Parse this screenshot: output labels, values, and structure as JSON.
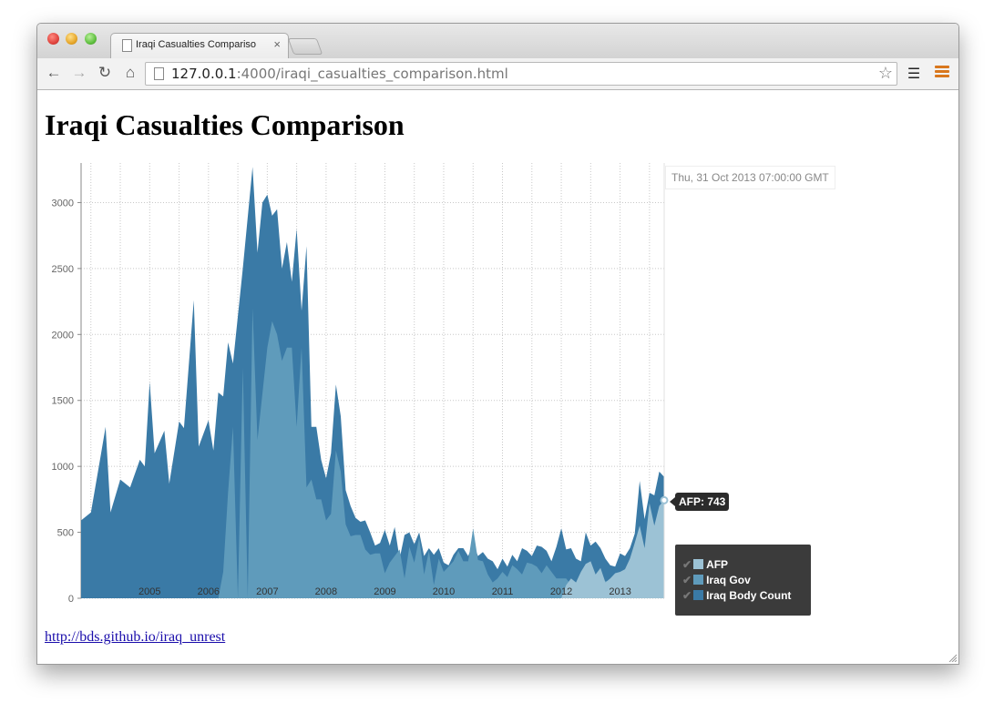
{
  "browser": {
    "tab_title": "Iraqi Casualties Compariso",
    "tab_close": "×",
    "url_host": "127.0.0.1",
    "url_rest": ":4000/iraqi_casualties_comparison.html"
  },
  "page": {
    "title": "Iraqi Casualties Comparison",
    "footer_link": "http://bds.github.io/iraq_unrest",
    "hover_date": "Thu, 31 Oct 2013 07:00:00 GMT",
    "tooltip": "AFP: 743"
  },
  "legend": {
    "items": [
      {
        "label": "AFP",
        "color": "#9cc2d5"
      },
      {
        "label": "Iraq Gov",
        "color": "#5f9bbb"
      },
      {
        "label": "Iraq Body Count",
        "color": "#3a7aa6"
      }
    ]
  },
  "chart_data": {
    "type": "area",
    "title": "Iraqi Casualties Comparison",
    "xlabel": "",
    "ylabel": "",
    "x_ticks": [
      "2005",
      "2006",
      "2007",
      "2008",
      "2009",
      "2010",
      "2011",
      "2012",
      "2013"
    ],
    "y_ticks": [
      0,
      500,
      1000,
      1500,
      2000,
      2500,
      3000
    ],
    "ylim": [
      0,
      3300
    ],
    "xlim": [
      "2003-11",
      "2013-10"
    ],
    "grid": true,
    "legend_position": "bottom-right",
    "series": [
      {
        "name": "Iraq Body Count",
        "color": "#3a7aa6",
        "points": [
          [
            "2003-11",
            590
          ],
          [
            "2004-01",
            650
          ],
          [
            "2004-03",
            1080
          ],
          [
            "2004-04",
            1300
          ],
          [
            "2004-05",
            650
          ],
          [
            "2004-07",
            900
          ],
          [
            "2004-09",
            840
          ],
          [
            "2004-11",
            1050
          ],
          [
            "2004-12",
            1000
          ],
          [
            "2005-01",
            1640
          ],
          [
            "2005-02",
            1100
          ],
          [
            "2005-04",
            1270
          ],
          [
            "2005-05",
            870
          ],
          [
            "2005-07",
            1340
          ],
          [
            "2005-08",
            1290
          ],
          [
            "2005-10",
            2260
          ],
          [
            "2005-11",
            1150
          ],
          [
            "2006-01",
            1350
          ],
          [
            "2006-02",
            1120
          ],
          [
            "2006-03",
            1560
          ],
          [
            "2006-04",
            1530
          ],
          [
            "2006-05",
            1940
          ],
          [
            "2006-06",
            1780
          ],
          [
            "2006-08",
            2500
          ],
          [
            "2006-10",
            3270
          ],
          [
            "2006-11",
            2620
          ],
          [
            "2006-12",
            3000
          ],
          [
            "2007-01",
            3060
          ],
          [
            "2007-02",
            2900
          ],
          [
            "2007-03",
            2950
          ],
          [
            "2007-04",
            2500
          ],
          [
            "2007-05",
            2700
          ],
          [
            "2007-06",
            2400
          ],
          [
            "2007-07",
            2800
          ],
          [
            "2007-08",
            2180
          ],
          [
            "2007-09",
            2670
          ],
          [
            "2007-10",
            1300
          ],
          [
            "2007-11",
            1300
          ],
          [
            "2007-12",
            1050
          ],
          [
            "2008-01",
            910
          ],
          [
            "2008-02",
            1100
          ],
          [
            "2008-03",
            1620
          ],
          [
            "2008-04",
            1380
          ],
          [
            "2008-05",
            820
          ],
          [
            "2008-06",
            700
          ],
          [
            "2008-07",
            610
          ],
          [
            "2008-08",
            580
          ],
          [
            "2008-09",
            590
          ],
          [
            "2008-10",
            500
          ],
          [
            "2008-11",
            400
          ],
          [
            "2008-12",
            420
          ],
          [
            "2009-01",
            520
          ],
          [
            "2009-02",
            400
          ],
          [
            "2009-03",
            540
          ],
          [
            "2009-04",
            300
          ],
          [
            "2009-05",
            480
          ],
          [
            "2009-06",
            500
          ],
          [
            "2009-07",
            410
          ],
          [
            "2009-08",
            500
          ],
          [
            "2009-09",
            320
          ],
          [
            "2009-10",
            380
          ],
          [
            "2009-11",
            330
          ],
          [
            "2009-12",
            380
          ],
          [
            "2010-01",
            270
          ],
          [
            "2010-02",
            250
          ],
          [
            "2010-03",
            330
          ],
          [
            "2010-04",
            380
          ],
          [
            "2010-05",
            380
          ],
          [
            "2010-06",
            320
          ],
          [
            "2010-07",
            420
          ],
          [
            "2010-08",
            320
          ],
          [
            "2010-09",
            350
          ],
          [
            "2010-10",
            300
          ],
          [
            "2010-11",
            280
          ],
          [
            "2010-12",
            220
          ],
          [
            "2011-01",
            300
          ],
          [
            "2011-02",
            240
          ],
          [
            "2011-03",
            330
          ],
          [
            "2011-04",
            280
          ],
          [
            "2011-05",
            380
          ],
          [
            "2011-06",
            360
          ],
          [
            "2011-07",
            320
          ],
          [
            "2011-08",
            400
          ],
          [
            "2011-09",
            390
          ],
          [
            "2011-10",
            360
          ],
          [
            "2011-11",
            280
          ],
          [
            "2011-12",
            390
          ],
          [
            "2012-01",
            530
          ],
          [
            "2012-02",
            370
          ],
          [
            "2012-03",
            380
          ],
          [
            "2012-04",
            300
          ],
          [
            "2012-05",
            280
          ],
          [
            "2012-06",
            500
          ],
          [
            "2012-07",
            400
          ],
          [
            "2012-08",
            430
          ],
          [
            "2012-09",
            380
          ],
          [
            "2012-10",
            300
          ],
          [
            "2012-11",
            250
          ],
          [
            "2012-12",
            240
          ],
          [
            "2013-01",
            340
          ],
          [
            "2013-02",
            320
          ],
          [
            "2013-03",
            380
          ],
          [
            "2013-04",
            490
          ],
          [
            "2013-05",
            890
          ],
          [
            "2013-06",
            600
          ],
          [
            "2013-07",
            800
          ],
          [
            "2013-08",
            780
          ],
          [
            "2013-09",
            960
          ],
          [
            "2013-10",
            920
          ]
        ]
      },
      {
        "name": "Iraq Gov",
        "color": "#5f9bbb",
        "points": [
          [
            "2006-03",
            0
          ],
          [
            "2006-04",
            200
          ],
          [
            "2006-05",
            800
          ],
          [
            "2006-06",
            1300
          ],
          [
            "2006-07",
            0
          ],
          [
            "2006-08",
            1750
          ],
          [
            "2006-09",
            0
          ],
          [
            "2006-10",
            2200
          ],
          [
            "2006-11",
            1200
          ],
          [
            "2007-01",
            1900
          ],
          [
            "2007-02",
            2100
          ],
          [
            "2007-03",
            2000
          ],
          [
            "2007-04",
            1800
          ],
          [
            "2007-05",
            1900
          ],
          [
            "2007-06",
            1900
          ],
          [
            "2007-07",
            1300
          ],
          [
            "2007-08",
            1900
          ],
          [
            "2007-09",
            840
          ],
          [
            "2007-10",
            900
          ],
          [
            "2007-11",
            750
          ],
          [
            "2007-12",
            750
          ],
          [
            "2008-01",
            590
          ],
          [
            "2008-02",
            640
          ],
          [
            "2008-03",
            1120
          ],
          [
            "2008-04",
            960
          ],
          [
            "2008-05",
            560
          ],
          [
            "2008-06",
            470
          ],
          [
            "2008-07",
            480
          ],
          [
            "2008-08",
            480
          ],
          [
            "2008-09",
            370
          ],
          [
            "2008-10",
            330
          ],
          [
            "2008-11",
            340
          ],
          [
            "2008-12",
            340
          ],
          [
            "2009-01",
            190
          ],
          [
            "2009-02",
            270
          ],
          [
            "2009-03",
            320
          ],
          [
            "2009-04",
            370
          ],
          [
            "2009-05",
            150
          ],
          [
            "2009-06",
            390
          ],
          [
            "2009-07",
            270
          ],
          [
            "2009-08",
            460
          ],
          [
            "2009-09",
            180
          ],
          [
            "2009-10",
            360
          ],
          [
            "2009-11",
            100
          ],
          [
            "2009-12",
            300
          ],
          [
            "2010-01",
            200
          ],
          [
            "2010-02",
            240
          ],
          [
            "2010-03",
            280
          ],
          [
            "2010-04",
            360
          ],
          [
            "2010-05",
            280
          ],
          [
            "2010-06",
            280
          ],
          [
            "2010-07",
            530
          ],
          [
            "2010-08",
            290
          ],
          [
            "2010-09",
            280
          ],
          [
            "2010-10",
            180
          ],
          [
            "2010-11",
            120
          ],
          [
            "2010-12",
            150
          ],
          [
            "2011-01",
            200
          ],
          [
            "2011-02",
            160
          ],
          [
            "2011-03",
            250
          ],
          [
            "2011-04",
            220
          ],
          [
            "2011-05",
            180
          ],
          [
            "2011-06",
            270
          ],
          [
            "2011-07",
            260
          ],
          [
            "2011-08",
            240
          ],
          [
            "2011-09",
            190
          ],
          [
            "2011-10",
            250
          ],
          [
            "2011-11",
            200
          ],
          [
            "2011-12",
            150
          ],
          [
            "2012-01",
            150
          ],
          [
            "2012-02",
            150
          ],
          [
            "2012-03",
            100
          ],
          [
            "2012-04",
            120
          ],
          [
            "2012-05",
            130
          ],
          [
            "2012-06",
            130
          ],
          [
            "2012-07",
            130
          ],
          [
            "2012-08",
            130
          ],
          [
            "2012-09",
            130
          ],
          [
            "2012-10",
            130
          ],
          [
            "2012-11",
            130
          ],
          [
            "2012-12",
            130
          ]
        ]
      },
      {
        "name": "AFP",
        "color": "#9cc2d5",
        "points": [
          [
            "2012-01",
            0
          ],
          [
            "2012-02",
            100
          ],
          [
            "2012-03",
            150
          ],
          [
            "2012-04",
            120
          ],
          [
            "2012-05",
            200
          ],
          [
            "2012-06",
            260
          ],
          [
            "2012-07",
            280
          ],
          [
            "2012-08",
            180
          ],
          [
            "2012-09",
            230
          ],
          [
            "2012-10",
            120
          ],
          [
            "2012-11",
            150
          ],
          [
            "2012-12",
            190
          ],
          [
            "2013-01",
            200
          ],
          [
            "2013-02",
            220
          ],
          [
            "2013-03",
            300
          ],
          [
            "2013-04",
            420
          ],
          [
            "2013-05",
            550
          ],
          [
            "2013-06",
            380
          ],
          [
            "2013-07",
            720
          ],
          [
            "2013-08",
            550
          ],
          [
            "2013-09",
            700
          ],
          [
            "2013-10",
            743
          ]
        ]
      }
    ]
  }
}
